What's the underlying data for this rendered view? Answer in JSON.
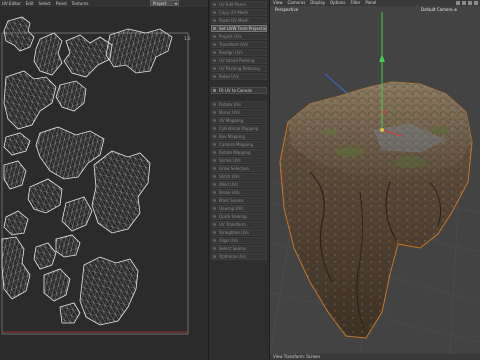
{
  "uv_editor": {
    "menu": [
      "UV Editor",
      "Edit",
      "Select",
      "Panel",
      "Textures"
    ],
    "dropdown": "Project",
    "axis_tick_top": "1.0"
  },
  "tools": [
    {
      "label": "UV Edit Panel",
      "style": "dim"
    },
    {
      "label": "Copy UV Mesh",
      "style": "dim"
    },
    {
      "label": "Paste UV Mesh",
      "style": "dim"
    },
    {
      "label": "Set UVW From Projection",
      "style": "hl",
      "gear": true
    },
    {
      "label": "Project UVs",
      "style": "dim",
      "gear": true
    },
    {
      "label": "Transform UVs",
      "style": "dim"
    },
    {
      "label": "Realign UVs",
      "style": "dim"
    },
    {
      "label": "UV Island Packing",
      "style": "dim"
    },
    {
      "label": "UV Packing Relaxing",
      "style": "dim"
    },
    {
      "label": "Relax UVs",
      "style": "dim"
    },
    {
      "gap": true
    },
    {
      "label": "Fit UV to Canvas",
      "style": "section",
      "gear": true
    },
    {
      "gap": true
    },
    {
      "label": "Rotate UVs",
      "style": "dim"
    },
    {
      "label": "Mirror UVs",
      "style": "dim"
    },
    {
      "label": "UV Mapping",
      "style": "dim"
    },
    {
      "label": "Cylindrical Mapping",
      "style": "dim"
    },
    {
      "label": "Box Mapping",
      "style": "dim"
    },
    {
      "label": "Camera Mapping",
      "style": "dim"
    },
    {
      "label": "Rotate Mapping",
      "style": "dim"
    },
    {
      "label": "Shrink UVs",
      "style": "dim"
    },
    {
      "label": "Grow Selection",
      "style": "dim"
    },
    {
      "label": "Stitch UVs",
      "style": "dim"
    },
    {
      "label": "Weld UVs",
      "style": "dim"
    },
    {
      "label": "Break UVs",
      "style": "dim"
    },
    {
      "label": "Mark Seams",
      "style": "dim"
    },
    {
      "label": "Unwrap UVs",
      "style": "dim"
    },
    {
      "label": "Quick Unwrap",
      "style": "dim"
    },
    {
      "label": "UV Transform",
      "style": "dim"
    },
    {
      "label": "Straighten UVs",
      "style": "dim"
    },
    {
      "label": "Align UVs",
      "style": "dim"
    },
    {
      "label": "Select Seams",
      "style": "dim"
    },
    {
      "label": "Optimize UVs",
      "style": "dim"
    }
  ],
  "viewport": {
    "menu": [
      "View",
      "Cameras",
      "Display",
      "Options",
      "Filter",
      "Panel"
    ],
    "camera_label": "Perspective",
    "default_camera": "Default Camera ⊕",
    "status": "View Transform: Screen"
  },
  "colors": {
    "uv_lines": "#d9d9d9",
    "viewport_bg": "#434343",
    "rock_base": "#6b5a46",
    "selection_outline": "#c97a2a",
    "axis_y": "#3fcf4a",
    "axis_x": "#d63b3b",
    "axis_z": "#3b6bd6"
  }
}
